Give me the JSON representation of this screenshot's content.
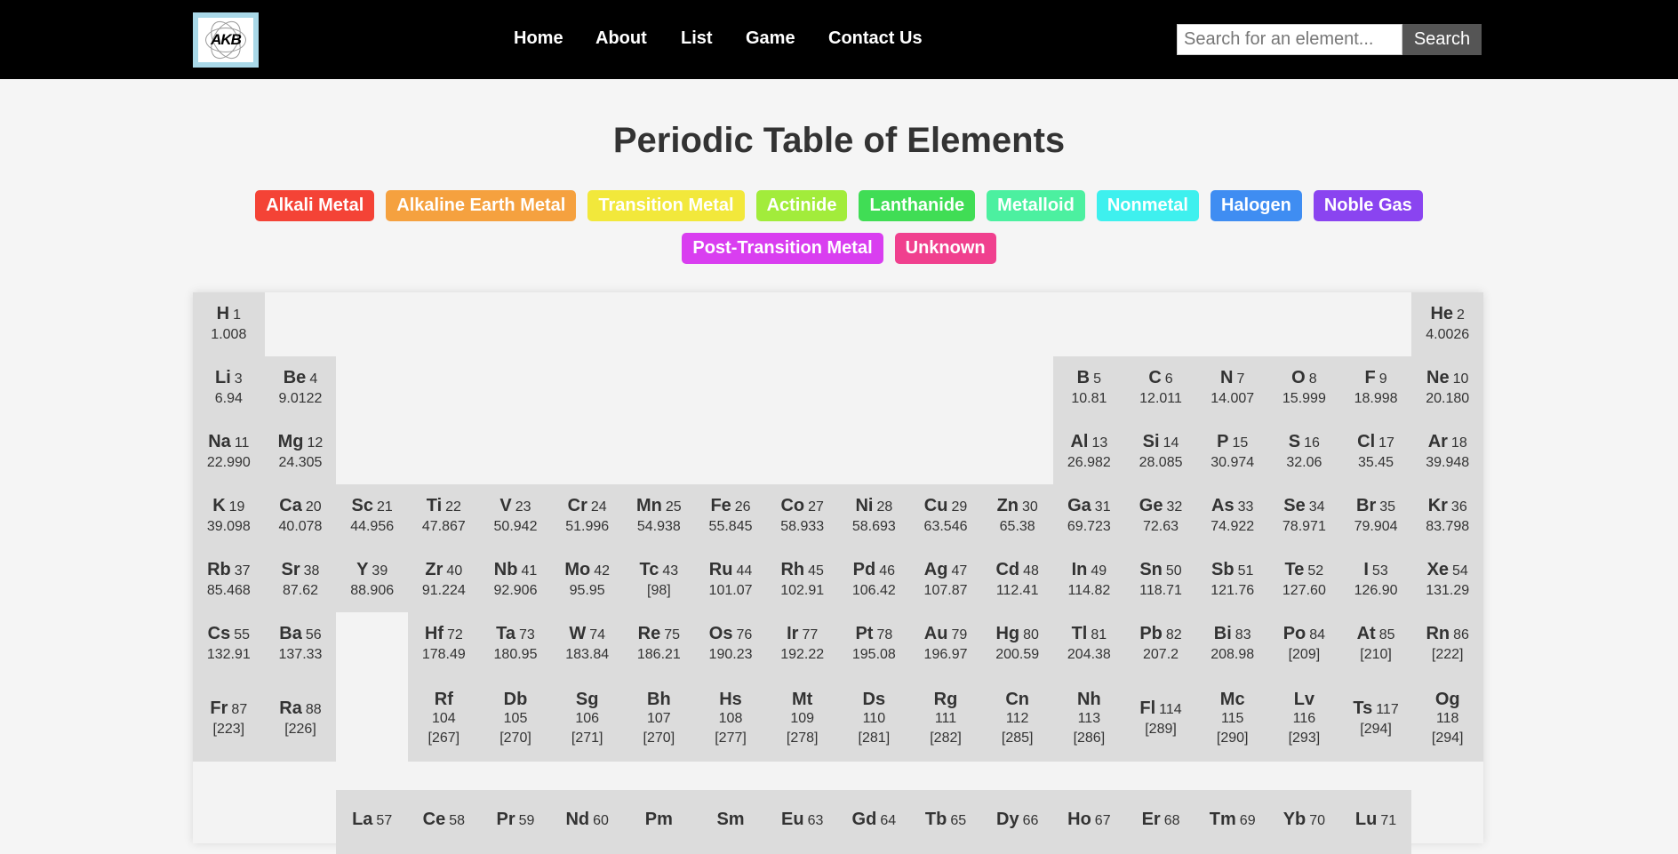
{
  "nav": {
    "logo_text": "AKB",
    "links": [
      "Home",
      "About",
      "List",
      "Game",
      "Contact Us"
    ],
    "search_placeholder": "Search for an element...",
    "search_button": "Search"
  },
  "page": {
    "title": "Periodic Table of Elements"
  },
  "legend": [
    {
      "label": "Alkali Metal",
      "color": "#f44336"
    },
    {
      "label": "Alkaline Earth Metal",
      "color": "#f5a13f"
    },
    {
      "label": "Transition Metal",
      "color": "#f2e83b"
    },
    {
      "label": "Actinide",
      "color": "#a2ec3b"
    },
    {
      "label": "Lanthanide",
      "color": "#40dd55"
    },
    {
      "label": "Metalloid",
      "color": "#4cf0a0"
    },
    {
      "label": "Nonmetal",
      "color": "#3ef0ee"
    },
    {
      "label": "Halogen",
      "color": "#3f8df2"
    },
    {
      "label": "Noble Gas",
      "color": "#8a44f0"
    },
    {
      "label": "Post-Transition Metal",
      "color": "#d93ef0"
    },
    {
      "label": "Unknown",
      "color": "#f0408e"
    }
  ],
  "elements": [
    {
      "symbol": "H",
      "number": "1",
      "mass": "1.008",
      "row": 1,
      "col": 1
    },
    {
      "symbol": "He",
      "number": "2",
      "mass": "4.0026",
      "row": 1,
      "col": 18
    },
    {
      "symbol": "Li",
      "number": "3",
      "mass": "6.94",
      "row": 2,
      "col": 1
    },
    {
      "symbol": "Be",
      "number": "4",
      "mass": "9.0122",
      "row": 2,
      "col": 2
    },
    {
      "symbol": "B",
      "number": "5",
      "mass": "10.81",
      "row": 2,
      "col": 13
    },
    {
      "symbol": "C",
      "number": "6",
      "mass": "12.011",
      "row": 2,
      "col": 14
    },
    {
      "symbol": "N",
      "number": "7",
      "mass": "14.007",
      "row": 2,
      "col": 15
    },
    {
      "symbol": "O",
      "number": "8",
      "mass": "15.999",
      "row": 2,
      "col": 16
    },
    {
      "symbol": "F",
      "number": "9",
      "mass": "18.998",
      "row": 2,
      "col": 17
    },
    {
      "symbol": "Ne",
      "number": "10",
      "mass": "20.180",
      "row": 2,
      "col": 18
    },
    {
      "symbol": "Na",
      "number": "11",
      "mass": "22.990",
      "row": 3,
      "col": 1
    },
    {
      "symbol": "Mg",
      "number": "12",
      "mass": "24.305",
      "row": 3,
      "col": 2
    },
    {
      "symbol": "Al",
      "number": "13",
      "mass": "26.982",
      "row": 3,
      "col": 13
    },
    {
      "symbol": "Si",
      "number": "14",
      "mass": "28.085",
      "row": 3,
      "col": 14
    },
    {
      "symbol": "P",
      "number": "15",
      "mass": "30.974",
      "row": 3,
      "col": 15
    },
    {
      "symbol": "S",
      "number": "16",
      "mass": "32.06",
      "row": 3,
      "col": 16
    },
    {
      "symbol": "Cl",
      "number": "17",
      "mass": "35.45",
      "row": 3,
      "col": 17
    },
    {
      "symbol": "Ar",
      "number": "18",
      "mass": "39.948",
      "row": 3,
      "col": 18
    },
    {
      "symbol": "K",
      "number": "19",
      "mass": "39.098",
      "row": 4,
      "col": 1
    },
    {
      "symbol": "Ca",
      "number": "20",
      "mass": "40.078",
      "row": 4,
      "col": 2
    },
    {
      "symbol": "Sc",
      "number": "21",
      "mass": "44.956",
      "row": 4,
      "col": 3
    },
    {
      "symbol": "Ti",
      "number": "22",
      "mass": "47.867",
      "row": 4,
      "col": 4
    },
    {
      "symbol": "V",
      "number": "23",
      "mass": "50.942",
      "row": 4,
      "col": 5
    },
    {
      "symbol": "Cr",
      "number": "24",
      "mass": "51.996",
      "row": 4,
      "col": 6
    },
    {
      "symbol": "Mn",
      "number": "25",
      "mass": "54.938",
      "row": 4,
      "col": 7
    },
    {
      "symbol": "Fe",
      "number": "26",
      "mass": "55.845",
      "row": 4,
      "col": 8
    },
    {
      "symbol": "Co",
      "number": "27",
      "mass": "58.933",
      "row": 4,
      "col": 9
    },
    {
      "symbol": "Ni",
      "number": "28",
      "mass": "58.693",
      "row": 4,
      "col": 10
    },
    {
      "symbol": "Cu",
      "number": "29",
      "mass": "63.546",
      "row": 4,
      "col": 11
    },
    {
      "symbol": "Zn",
      "number": "30",
      "mass": "65.38",
      "row": 4,
      "col": 12
    },
    {
      "symbol": "Ga",
      "number": "31",
      "mass": "69.723",
      "row": 4,
      "col": 13
    },
    {
      "symbol": "Ge",
      "number": "32",
      "mass": "72.63",
      "row": 4,
      "col": 14
    },
    {
      "symbol": "As",
      "number": "33",
      "mass": "74.922",
      "row": 4,
      "col": 15
    },
    {
      "symbol": "Se",
      "number": "34",
      "mass": "78.971",
      "row": 4,
      "col": 16
    },
    {
      "symbol": "Br",
      "number": "35",
      "mass": "79.904",
      "row": 4,
      "col": 17
    },
    {
      "symbol": "Kr",
      "number": "36",
      "mass": "83.798",
      "row": 4,
      "col": 18
    },
    {
      "symbol": "Rb",
      "number": "37",
      "mass": "85.468",
      "row": 5,
      "col": 1
    },
    {
      "symbol": "Sr",
      "number": "38",
      "mass": "87.62",
      "row": 5,
      "col": 2
    },
    {
      "symbol": "Y",
      "number": "39",
      "mass": "88.906",
      "row": 5,
      "col": 3
    },
    {
      "symbol": "Zr",
      "number": "40",
      "mass": "91.224",
      "row": 5,
      "col": 4
    },
    {
      "symbol": "Nb",
      "number": "41",
      "mass": "92.906",
      "row": 5,
      "col": 5
    },
    {
      "symbol": "Mo",
      "number": "42",
      "mass": "95.95",
      "row": 5,
      "col": 6
    },
    {
      "symbol": "Tc",
      "number": "43",
      "mass": "[98]",
      "row": 5,
      "col": 7
    },
    {
      "symbol": "Ru",
      "number": "44",
      "mass": "101.07",
      "row": 5,
      "col": 8
    },
    {
      "symbol": "Rh",
      "number": "45",
      "mass": "102.91",
      "row": 5,
      "col": 9
    },
    {
      "symbol": "Pd",
      "number": "46",
      "mass": "106.42",
      "row": 5,
      "col": 10
    },
    {
      "symbol": "Ag",
      "number": "47",
      "mass": "107.87",
      "row": 5,
      "col": 11
    },
    {
      "symbol": "Cd",
      "number": "48",
      "mass": "112.41",
      "row": 5,
      "col": 12
    },
    {
      "symbol": "In",
      "number": "49",
      "mass": "114.82",
      "row": 5,
      "col": 13
    },
    {
      "symbol": "Sn",
      "number": "50",
      "mass": "118.71",
      "row": 5,
      "col": 14
    },
    {
      "symbol": "Sb",
      "number": "51",
      "mass": "121.76",
      "row": 5,
      "col": 15
    },
    {
      "symbol": "Te",
      "number": "52",
      "mass": "127.60",
      "row": 5,
      "col": 16
    },
    {
      "symbol": "I",
      "number": "53",
      "mass": "126.90",
      "row": 5,
      "col": 17
    },
    {
      "symbol": "Xe",
      "number": "54",
      "mass": "131.29",
      "row": 5,
      "col": 18
    },
    {
      "symbol": "Cs",
      "number": "55",
      "mass": "132.91",
      "row": 6,
      "col": 1
    },
    {
      "symbol": "Ba",
      "number": "56",
      "mass": "137.33",
      "row": 6,
      "col": 2
    },
    {
      "symbol": "Hf",
      "number": "72",
      "mass": "178.49",
      "row": 6,
      "col": 4
    },
    {
      "symbol": "Ta",
      "number": "73",
      "mass": "180.95",
      "row": 6,
      "col": 5
    },
    {
      "symbol": "W",
      "number": "74",
      "mass": "183.84",
      "row": 6,
      "col": 6
    },
    {
      "symbol": "Re",
      "number": "75",
      "mass": "186.21",
      "row": 6,
      "col": 7
    },
    {
      "symbol": "Os",
      "number": "76",
      "mass": "190.23",
      "row": 6,
      "col": 8
    },
    {
      "symbol": "Ir",
      "number": "77",
      "mass": "192.22",
      "row": 6,
      "col": 9
    },
    {
      "symbol": "Pt",
      "number": "78",
      "mass": "195.08",
      "row": 6,
      "col": 10
    },
    {
      "symbol": "Au",
      "number": "79",
      "mass": "196.97",
      "row": 6,
      "col": 11
    },
    {
      "symbol": "Hg",
      "number": "80",
      "mass": "200.59",
      "row": 6,
      "col": 12
    },
    {
      "symbol": "Tl",
      "number": "81",
      "mass": "204.38",
      "row": 6,
      "col": 13
    },
    {
      "symbol": "Pb",
      "number": "82",
      "mass": "207.2",
      "row": 6,
      "col": 14
    },
    {
      "symbol": "Bi",
      "number": "83",
      "mass": "208.98",
      "row": 6,
      "col": 15
    },
    {
      "symbol": "Po",
      "number": "84",
      "mass": "[209]",
      "row": 6,
      "col": 16
    },
    {
      "symbol": "At",
      "number": "85",
      "mass": "[210]",
      "row": 6,
      "col": 17
    },
    {
      "symbol": "Rn",
      "number": "86",
      "mass": "[222]",
      "row": 6,
      "col": 18
    },
    {
      "symbol": "Fr",
      "number": "87",
      "mass": "[223]",
      "row": 7,
      "col": 1
    },
    {
      "symbol": "Ra",
      "number": "88",
      "mass": "[226]",
      "row": 7,
      "col": 2
    },
    {
      "symbol": "Rf",
      "number": "104",
      "mass": "[267]",
      "row": 7,
      "col": 4,
      "stack": true
    },
    {
      "symbol": "Db",
      "number": "105",
      "mass": "[270]",
      "row": 7,
      "col": 5,
      "stack": true
    },
    {
      "symbol": "Sg",
      "number": "106",
      "mass": "[271]",
      "row": 7,
      "col": 6,
      "stack": true
    },
    {
      "symbol": "Bh",
      "number": "107",
      "mass": "[270]",
      "row": 7,
      "col": 7,
      "stack": true
    },
    {
      "symbol": "Hs",
      "number": "108",
      "mass": "[277]",
      "row": 7,
      "col": 8,
      "stack": true
    },
    {
      "symbol": "Mt",
      "number": "109",
      "mass": "[278]",
      "row": 7,
      "col": 9,
      "stack": true
    },
    {
      "symbol": "Ds",
      "number": "110",
      "mass": "[281]",
      "row": 7,
      "col": 10,
      "stack": true
    },
    {
      "symbol": "Rg",
      "number": "111",
      "mass": "[282]",
      "row": 7,
      "col": 11,
      "stack": true
    },
    {
      "symbol": "Cn",
      "number": "112",
      "mass": "[285]",
      "row": 7,
      "col": 12,
      "stack": true
    },
    {
      "symbol": "Nh",
      "number": "113",
      "mass": "[286]",
      "row": 7,
      "col": 13,
      "stack": true
    },
    {
      "symbol": "Fl",
      "number": "114",
      "mass": "[289]",
      "row": 7,
      "col": 14
    },
    {
      "symbol": "Mc",
      "number": "115",
      "mass": "[290]",
      "row": 7,
      "col": 15,
      "stack": true
    },
    {
      "symbol": "Lv",
      "number": "116",
      "mass": "[293]",
      "row": 7,
      "col": 16,
      "stack": true
    },
    {
      "symbol": "Ts",
      "number": "117",
      "mass": "[294]",
      "row": 7,
      "col": 17
    },
    {
      "symbol": "Og",
      "number": "118",
      "mass": "[294]",
      "row": 7,
      "col": 18,
      "stack": true
    },
    {
      "symbol": "La",
      "number": "57",
      "mass": "",
      "row": 9,
      "col": 3
    },
    {
      "symbol": "Ce",
      "number": "58",
      "mass": "",
      "row": 9,
      "col": 4
    },
    {
      "symbol": "Pr",
      "number": "59",
      "mass": "",
      "row": 9,
      "col": 5
    },
    {
      "symbol": "Nd",
      "number": "60",
      "mass": "",
      "row": 9,
      "col": 6
    },
    {
      "symbol": "Pm",
      "number": "",
      "mass": "",
      "row": 9,
      "col": 7,
      "stack": true
    },
    {
      "symbol": "Sm",
      "number": "",
      "mass": "",
      "row": 9,
      "col": 8,
      "stack": true
    },
    {
      "symbol": "Eu",
      "number": "63",
      "mass": "",
      "row": 9,
      "col": 9
    },
    {
      "symbol": "Gd",
      "number": "64",
      "mass": "",
      "row": 9,
      "col": 10
    },
    {
      "symbol": "Tb",
      "number": "65",
      "mass": "",
      "row": 9,
      "col": 11
    },
    {
      "symbol": "Dy",
      "number": "66",
      "mass": "",
      "row": 9,
      "col": 12
    },
    {
      "symbol": "Ho",
      "number": "67",
      "mass": "",
      "row": 9,
      "col": 13
    },
    {
      "symbol": "Er",
      "number": "68",
      "mass": "",
      "row": 9,
      "col": 14
    },
    {
      "symbol": "Tm",
      "number": "69",
      "mass": "",
      "row": 9,
      "col": 15
    },
    {
      "symbol": "Yb",
      "number": "70",
      "mass": "",
      "row": 9,
      "col": 16
    },
    {
      "symbol": "Lu",
      "number": "71",
      "mass": "",
      "row": 9,
      "col": 17
    }
  ]
}
